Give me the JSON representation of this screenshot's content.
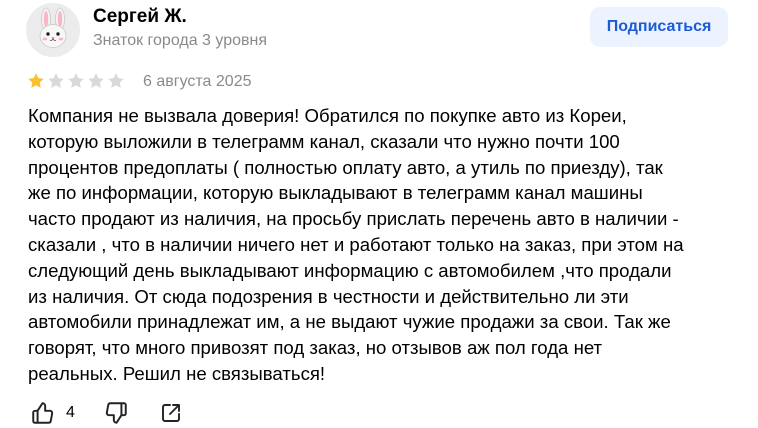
{
  "author": {
    "name": "Сергей Ж.",
    "level": "Знаток города 3 уровня",
    "avatar_icon": "rabbit-avatar-icon"
  },
  "subscribe_button": {
    "label": "Подписаться"
  },
  "review": {
    "rating": 1,
    "rating_max": 5,
    "date": "6 августа 2025",
    "text_lines": [
      "Компания не вызвала доверия! Обратился по покупке авто из Кореи,",
      "которую выложили в телеграмм канал, сказали что нужно почти 100",
      "процентов предоплаты ( полностью оплату авто, а утиль по приезду), так",
      "же по информации, которую выкладывают в телеграмм канал машины",
      "часто продают из наличия, на просьбу прислать перечень авто в наличии -",
      "сказали , что в наличии ничего нет и работают только на заказ, при этом на",
      "следующий день выкладывают информацию с автомобилем ,что продали",
      "из наличия. От сюда подозрения в честности и действительно ли эти",
      "автомобили принадлежат им, а не выдают чужие продажи за свои. Так же",
      "говорят, что много привозят под заказ, но отзывов аж пол года нет",
      "реальных. Решил не связываться!"
    ]
  },
  "actions": {
    "like_count": "4",
    "like_icon": "thumbs-up-icon",
    "dislike_icon": "thumbs-down-icon",
    "share_icon": "share-icon"
  },
  "colors": {
    "star_filled": "#fbc02d",
    "star_empty": "#d9d9d9",
    "accent_text": "#1a5cd6",
    "accent_bg": "#edf3fe",
    "muted_text": "#8a8a8a"
  }
}
